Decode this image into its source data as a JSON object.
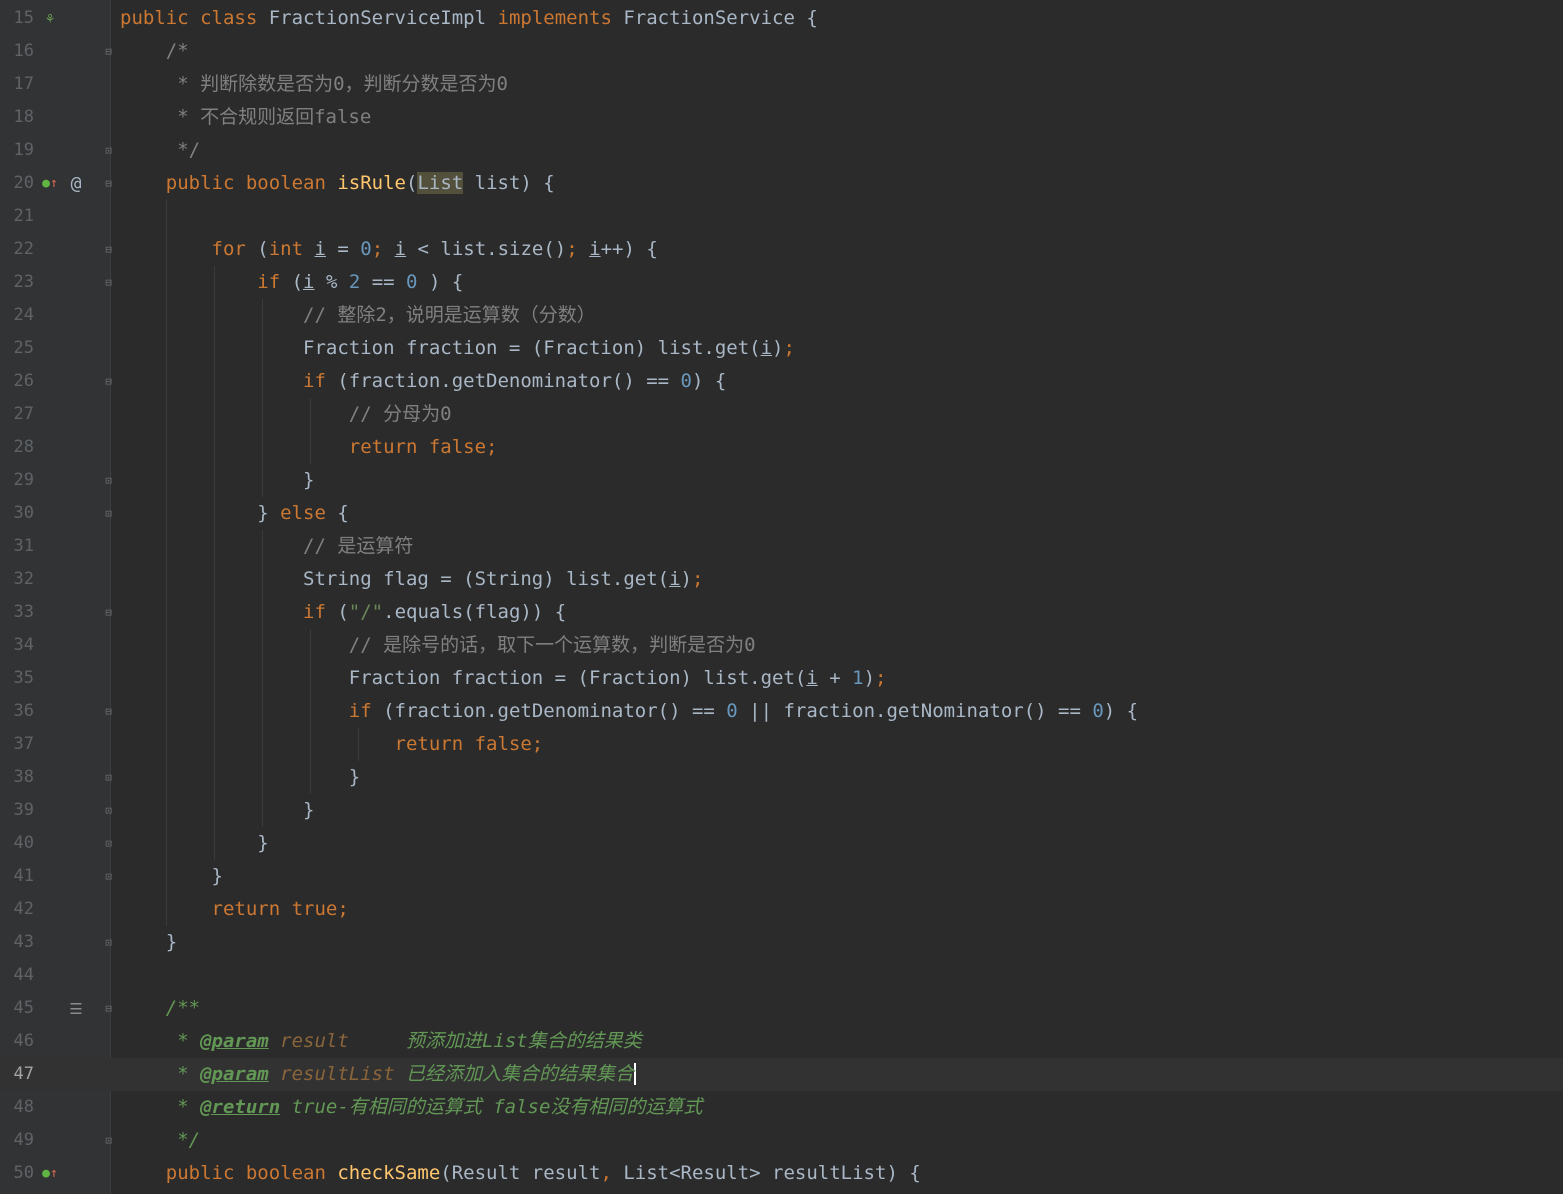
{
  "editor": {
    "language": "java",
    "current_line": "47",
    "lines": [
      {
        "num": "15",
        "parts": [
          [
            "kw",
            "public class "
          ],
          [
            "",
            "FractionServiceImpl "
          ],
          [
            "kw",
            "implements "
          ],
          [
            "",
            "FractionService {"
          ]
        ]
      },
      {
        "num": "16",
        "parts": [
          [
            "cmt",
            "    /*"
          ]
        ]
      },
      {
        "num": "17",
        "parts": [
          [
            "cmt",
            "     * 判断除数是否为0，判断分数是否为0"
          ]
        ]
      },
      {
        "num": "18",
        "parts": [
          [
            "cmt",
            "     * 不合规则返回false"
          ]
        ]
      },
      {
        "num": "19",
        "parts": [
          [
            "cmt",
            "     */"
          ]
        ]
      },
      {
        "num": "20",
        "parts": [
          [
            "kw",
            "    public boolean "
          ],
          [
            "fn",
            "isRule"
          ],
          [
            "",
            "("
          ],
          [
            "hl",
            "List"
          ],
          [
            "",
            " list) {"
          ]
        ]
      },
      {
        "num": "21",
        "parts": [
          [
            "",
            ""
          ]
        ]
      },
      {
        "num": "22",
        "parts": [
          [
            "kw",
            "        for "
          ],
          [
            "",
            "("
          ],
          [
            "kw",
            "int "
          ],
          [
            "ul",
            "i"
          ],
          [
            "",
            " = "
          ],
          [
            "num",
            "0"
          ],
          [
            "kw",
            "; "
          ],
          [
            "ul",
            "i"
          ],
          [
            "",
            " < list.size()"
          ],
          [
            "kw",
            "; "
          ],
          [
            "ul",
            "i"
          ],
          [
            "",
            "++) {"
          ]
        ]
      },
      {
        "num": "23",
        "parts": [
          [
            "kw",
            "            if "
          ],
          [
            "",
            "("
          ],
          [
            "ul",
            "i"
          ],
          [
            "",
            " % "
          ],
          [
            "num",
            "2"
          ],
          [
            "",
            " == "
          ],
          [
            "num",
            "0"
          ],
          [
            "",
            " ) {"
          ]
        ]
      },
      {
        "num": "24",
        "parts": [
          [
            "cmt",
            "                // 整除2，说明是运算数（分数）"
          ]
        ]
      },
      {
        "num": "25",
        "parts": [
          [
            "",
            "                Fraction fraction = (Fraction) list.get("
          ],
          [
            "ul",
            "i"
          ],
          [
            "",
            ")"
          ],
          [
            "kw",
            ";"
          ]
        ]
      },
      {
        "num": "26",
        "parts": [
          [
            "kw",
            "                if "
          ],
          [
            "",
            "(fraction.getDenominator() == "
          ],
          [
            "num",
            "0"
          ],
          [
            "",
            ") {"
          ]
        ]
      },
      {
        "num": "27",
        "parts": [
          [
            "cmt",
            "                    // 分母为0"
          ]
        ]
      },
      {
        "num": "28",
        "parts": [
          [
            "kw",
            "                    return false;"
          ]
        ]
      },
      {
        "num": "29",
        "parts": [
          [
            "",
            "                }"
          ]
        ]
      },
      {
        "num": "30",
        "parts": [
          [
            "",
            "            } "
          ],
          [
            "kw",
            "else "
          ],
          [
            "",
            "{"
          ]
        ]
      },
      {
        "num": "31",
        "parts": [
          [
            "cmt",
            "                // 是运算符"
          ]
        ]
      },
      {
        "num": "32",
        "parts": [
          [
            "",
            "                String flag = (String) list.get("
          ],
          [
            "ul",
            "i"
          ],
          [
            "",
            ")"
          ],
          [
            "kw",
            ";"
          ]
        ]
      },
      {
        "num": "33",
        "parts": [
          [
            "kw",
            "                if "
          ],
          [
            "",
            "("
          ],
          [
            "str",
            "\"/\""
          ],
          [
            "",
            ".equals(flag)) {"
          ]
        ]
      },
      {
        "num": "34",
        "parts": [
          [
            "cmt",
            "                    // 是除号的话，取下一个运算数，判断是否为0"
          ]
        ]
      },
      {
        "num": "35",
        "parts": [
          [
            "",
            "                    Fraction fraction = (Fraction) list.get("
          ],
          [
            "ul",
            "i"
          ],
          [
            "",
            " + "
          ],
          [
            "num",
            "1"
          ],
          [
            "",
            ")"
          ],
          [
            "kw",
            ";"
          ]
        ]
      },
      {
        "num": "36",
        "parts": [
          [
            "kw",
            "                    if "
          ],
          [
            "",
            "(fraction.getDenominator() == "
          ],
          [
            "num",
            "0"
          ],
          [
            "",
            " || fraction.getNominator() == "
          ],
          [
            "num",
            "0"
          ],
          [
            "",
            ") {"
          ]
        ]
      },
      {
        "num": "37",
        "parts": [
          [
            "kw",
            "                        return false;"
          ]
        ]
      },
      {
        "num": "38",
        "parts": [
          [
            "",
            "                    }"
          ]
        ]
      },
      {
        "num": "39",
        "parts": [
          [
            "",
            "                }"
          ]
        ]
      },
      {
        "num": "40",
        "parts": [
          [
            "",
            "            }"
          ]
        ]
      },
      {
        "num": "41",
        "parts": [
          [
            "",
            "        }"
          ]
        ]
      },
      {
        "num": "42",
        "parts": [
          [
            "kw",
            "        return true;"
          ]
        ]
      },
      {
        "num": "43",
        "parts": [
          [
            "",
            "    }"
          ]
        ]
      },
      {
        "num": "44",
        "parts": [
          [
            "",
            ""
          ]
        ]
      },
      {
        "num": "45",
        "parts": [
          [
            "doc",
            "    /**"
          ]
        ]
      },
      {
        "num": "46",
        "parts": [
          [
            "doc",
            "     * "
          ],
          [
            "tag",
            "@param"
          ],
          [
            "pname",
            " result"
          ],
          [
            "doc",
            "     预添加进List集合的结果类"
          ]
        ]
      },
      {
        "num": "47",
        "parts": [
          [
            "doc",
            "     * "
          ],
          [
            "tag",
            "@param"
          ],
          [
            "pname",
            " resultList"
          ],
          [
            "doc",
            " 已经添加入集合的结果集合"
          ]
        ]
      },
      {
        "num": "48",
        "parts": [
          [
            "doc",
            "     * "
          ],
          [
            "tag",
            "@return"
          ],
          [
            "doc",
            " true-有相同的运算式 false没有相同的运算式"
          ]
        ]
      },
      {
        "num": "49",
        "parts": [
          [
            "doc",
            "     */"
          ]
        ]
      },
      {
        "num": "50",
        "parts": [
          [
            "kw",
            "    public boolean "
          ],
          [
            "fn",
            "checkSame"
          ],
          [
            "",
            "(Result result"
          ],
          [
            "kw",
            ", "
          ],
          [
            "",
            "List<Result> resultList) {"
          ]
        ]
      }
    ],
    "gutter_markers": {
      "15": {
        "type": "bean",
        "icon": "spring-bean-icon",
        "glyph": "⚘"
      },
      "20": {
        "type": "override",
        "icon": "implements-method-icon",
        "glyph": "●",
        "glyph2": "↑",
        "extra_icon": "annotation-at-icon",
        "extra_glyph": "@"
      },
      "45": {
        "type": "doc",
        "icon": "rendered-doc-toggle-icon",
        "glyph": "☰"
      },
      "50": {
        "type": "override",
        "icon": "implements-method-icon",
        "glyph": "●",
        "glyph2": "↑"
      }
    },
    "fold_open_lines": [
      "16",
      "20",
      "22",
      "23",
      "26",
      "33",
      "36",
      "45"
    ],
    "fold_close_lines": [
      "19",
      "29",
      "30",
      "38",
      "39",
      "40",
      "41",
      "43",
      "49"
    ],
    "fold_open_glyph": "⊟",
    "fold_close_glyph": "⊡",
    "colors": {
      "background": "#2b2b2b",
      "keyword": "#cc7832",
      "number": "#6897bb",
      "string": "#6a8759",
      "comment": "#808080",
      "doc": "#629755",
      "method": "#ffc66d",
      "text": "#a9b7c6"
    }
  }
}
